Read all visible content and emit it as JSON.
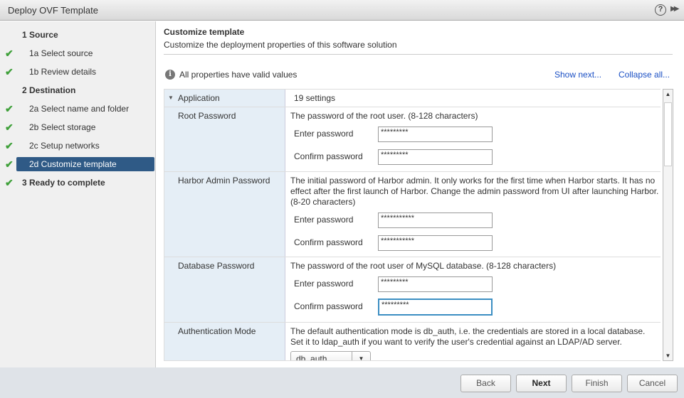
{
  "window": {
    "title": "Deploy OVF Template",
    "help_icon": "?",
    "expand_icon": "▶▶"
  },
  "steps": [
    {
      "label": "1  Source",
      "done": false
    },
    {
      "label": "1a  Select source",
      "done": true
    },
    {
      "label": "1b  Review details",
      "done": true
    },
    {
      "label": "2  Destination",
      "done": false
    },
    {
      "label": "2a  Select name and folder",
      "done": true
    },
    {
      "label": "2b  Select storage",
      "done": true
    },
    {
      "label": "2c  Setup networks",
      "done": true
    },
    {
      "label": "2d  Customize template",
      "done": true,
      "selected": true
    },
    {
      "label": "3  Ready to complete",
      "done": true
    }
  ],
  "main": {
    "title": "Customize template",
    "subtitle": "Customize the deployment properties of this software solution",
    "status": "All properties have valid values",
    "show_next": "Show next...",
    "collapse_all": "Collapse all..."
  },
  "grid": {
    "group": {
      "name": "Application",
      "count": "19 settings"
    },
    "enter_label": "Enter password",
    "confirm_label": "Confirm password",
    "root": {
      "name": "Root Password",
      "desc": "The password of the root user.  (8-128 characters)",
      "enter": "*********",
      "confirm": "*********"
    },
    "harbor": {
      "name": "Harbor Admin Password",
      "desc": [
        "The initial password of Harbor admin. It only works for the first time when Harbor starts. It has no",
        "effect after the first launch of Harbor. Change the admin password from UI after launching Harbor.",
        "(8-20 characters)"
      ],
      "enter": "***********",
      "confirm": "***********"
    },
    "db": {
      "name": "Database Password",
      "desc": "The password of the root user of MySQL database.  (8-128 characters)",
      "enter": "*********",
      "confirm": "*********"
    },
    "auth": {
      "name": "Authentication Mode",
      "desc": [
        "The default authentication mode is db_auth, i.e. the credentials are stored in a local database.",
        "Set it to ldap_auth if you want to verify the user's credential against an LDAP/AD server."
      ],
      "value": "db_auth"
    }
  },
  "footer": {
    "back": "Back",
    "next": "Next",
    "finish": "Finish",
    "cancel": "Cancel"
  }
}
